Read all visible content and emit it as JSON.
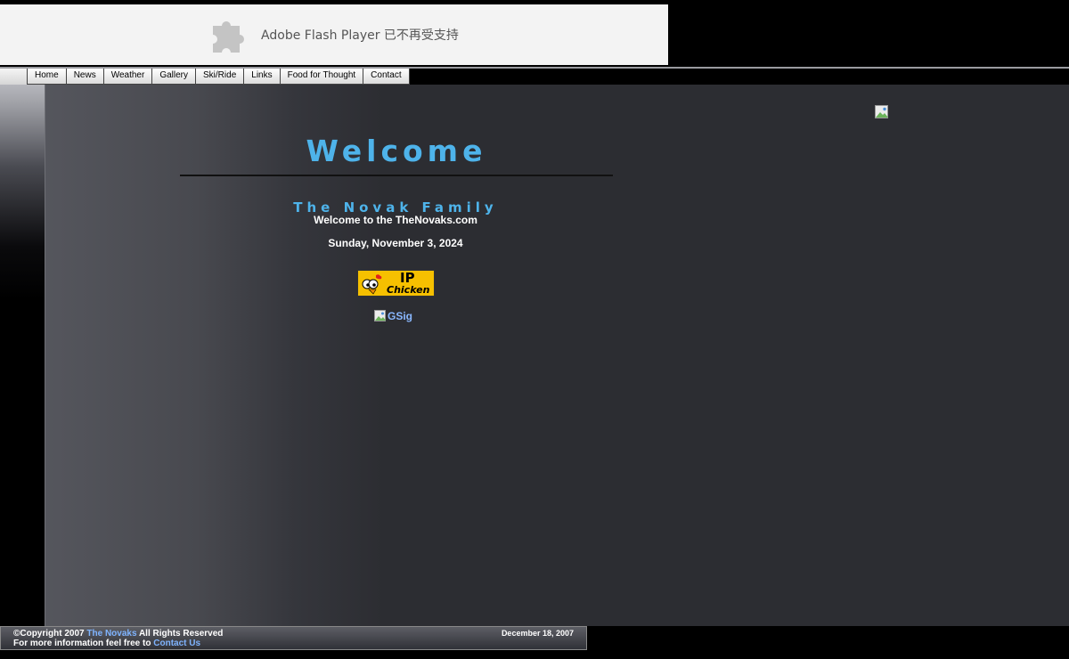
{
  "flash": {
    "icon": "puzzle-piece-icon",
    "text": "Adobe Flash Player 已不再受支持"
  },
  "nav": {
    "items": [
      "Home",
      "News",
      "Weather",
      "Gallery",
      "Ski/Ride",
      "Links",
      "Food for Thought",
      "Contact"
    ]
  },
  "main": {
    "heading": "Welcome",
    "family": "The Novak Family",
    "subtitle": "Welcome to the TheNovaks.com",
    "date": "Sunday, November 3, 2024",
    "ipchicken": {
      "ip": "IP",
      "chicken": "Chicken"
    },
    "gsig_alt": "GSig"
  },
  "footer": {
    "copyright_prefix": "©Copyright 2007 ",
    "owner_link": "The Novaks",
    "copyright_suffix": " All Rights Reserved",
    "info_prefix": "For more information feel free to ",
    "contact_link": "Contact Us",
    "date": "December 18, 2007"
  },
  "colors": {
    "accent": "#4eb3ea",
    "link": "#7fb4ff",
    "panel": "#2c2d32"
  }
}
